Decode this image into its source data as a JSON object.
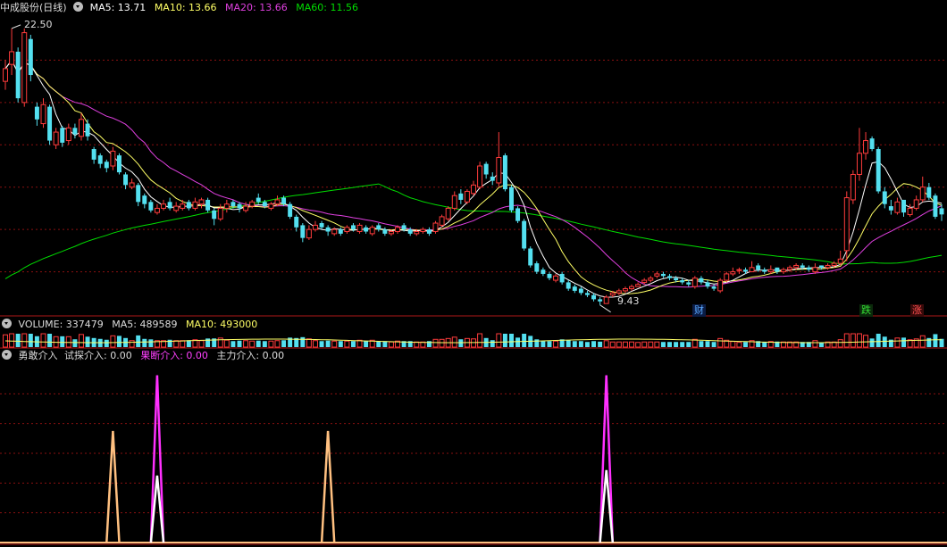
{
  "colors": {
    "bg": "#000000",
    "grid": "#8a1010",
    "up": "#ff3c3c",
    "down": "#54e0f0",
    "ma5": "#ffffff",
    "ma10": "#ffff66",
    "ma20": "#e040e0",
    "ma60": "#00dd00",
    "ind_orange": "#ffc080",
    "ind_magenta": "#ff30ff",
    "ind_white": "#ffffff",
    "label": "#dddddd"
  },
  "price_panel": {
    "title": "中成股份(日线)",
    "ma": [
      {
        "label": "MA5: 13.71",
        "color": "#ffffff"
      },
      {
        "label": "MA10: 13.66",
        "color": "#ffff66"
      },
      {
        "label": "MA20: 13.66",
        "color": "#e040e0"
      },
      {
        "label": "MA60: 11.56",
        "color": "#00dd00"
      }
    ],
    "high_label": "22.50",
    "low_label": "9.43",
    "tags": [
      {
        "text": "财",
        "color": "#5aa8ff",
        "bg": "#0b1c44"
      },
      {
        "text": "跌",
        "color": "#33dd33",
        "bg": "#0b2a0b"
      },
      {
        "text": "涨",
        "color": "#ff5050",
        "bg": "#3a0a0a"
      }
    ]
  },
  "volume_panel": {
    "items": [
      {
        "label": "VOLUME: 337479",
        "color": "#dddddd"
      },
      {
        "label": "MA5: 489589",
        "color": "#dddddd"
      },
      {
        "label": "MA10: 493000",
        "color": "#ffff66"
      }
    ]
  },
  "indicator_panel": {
    "items": [
      {
        "label": "勇敢介入",
        "color": "#dddddd"
      },
      {
        "label": "试探介入: 0.00",
        "color": "#dddddd"
      },
      {
        "label": "果断介入: 0.00",
        "color": "#ff40ff"
      },
      {
        "label": "主力介入: 0.00",
        "color": "#dddddd"
      }
    ]
  },
  "chart_data": [
    {
      "type": "candlestick",
      "title": "中成股份(日线)",
      "y_range": [
        9.0,
        23.0
      ],
      "high": 22.5,
      "low": 9.43,
      "closes": [
        20.6,
        21.4,
        19.2,
        22.3,
        20.3,
        18.2,
        18.9,
        17.2,
        17.6,
        17.1,
        17.8,
        17.5,
        18.2,
        17.4,
        16.3,
        16.1,
        15.9,
        16.7,
        15.7,
        15.1,
        15.2,
        14.3,
        14.2,
        13.9,
        14.0,
        14.2,
        14.0,
        14.1,
        14.2,
        14.0,
        14.3,
        14.4,
        13.9,
        13.5,
        14.0,
        14.2,
        14.1,
        14.0,
        14.1,
        14.3,
        14.3,
        14.1,
        14.2,
        14.4,
        14.2,
        13.6,
        13.1,
        12.6,
        13.0,
        13.2,
        13.1,
        12.9,
        13.0,
        12.8,
        13.1,
        13.0,
        13.2,
        12.9,
        13.1,
        13.0,
        12.8,
        12.9,
        13.1,
        13.0,
        12.8,
        12.9,
        13.0,
        12.8,
        13.3,
        13.6,
        14.0,
        14.6,
        14.4,
        14.8,
        15.1,
        16.0,
        15.6,
        15.3,
        16.4,
        14.9,
        13.9,
        13.4,
        12.1,
        11.3,
        11.0,
        10.9,
        10.7,
        10.8,
        10.5,
        10.2,
        10.1,
        10.0,
        9.9,
        9.7,
        9.6,
        9.8,
        10.0,
        10.1,
        10.2,
        10.3,
        10.4,
        10.6,
        10.7,
        10.9,
        10.8,
        10.7,
        10.6,
        10.5,
        10.4,
        10.7,
        10.5,
        10.3,
        10.2,
        10.6,
        10.9,
        11.0,
        11.1,
        11.0,
        11.2,
        11.1,
        11.0,
        11.1,
        11.0,
        11.1,
        11.2,
        11.3,
        11.2,
        11.1,
        11.2,
        11.2,
        11.3,
        11.4,
        11.6,
        14.5,
        15.6,
        16.6,
        17.2,
        16.8,
        14.8,
        14.2,
        13.9,
        14.3,
        13.8,
        14.0,
        14.4,
        15.0,
        14.5,
        13.6,
        13.71
      ],
      "opens": [
        20.0,
        20.8,
        21.4,
        19.0,
        22.0,
        18.8,
        18.0,
        18.8,
        17.0,
        17.8,
        17.2,
        17.8,
        17.4,
        18.0,
        16.8,
        16.5,
        16.2,
        16.0,
        16.5,
        15.6,
        15.0,
        15.1,
        14.6,
        14.3,
        13.8,
        14.0,
        14.3,
        13.9,
        14.0,
        14.3,
        14.0,
        14.2,
        14.4,
        13.9,
        13.5,
        14.0,
        14.3,
        14.2,
        13.9,
        14.1,
        14.5,
        14.3,
        14.0,
        14.2,
        14.5,
        14.2,
        13.6,
        13.2,
        12.6,
        13.0,
        13.3,
        13.1,
        12.8,
        13.0,
        12.9,
        13.2,
        12.9,
        13.1,
        12.8,
        13.2,
        13.0,
        12.8,
        12.9,
        13.2,
        13.0,
        12.8,
        12.9,
        13.0,
        12.9,
        13.2,
        13.5,
        14.0,
        14.7,
        14.3,
        14.7,
        15.0,
        16.1,
        15.5,
        15.2,
        16.5,
        15.0,
        14.0,
        13.4,
        12.1,
        11.4,
        11.1,
        10.9,
        10.6,
        10.9,
        10.5,
        10.3,
        10.2,
        10.0,
        9.9,
        9.7,
        9.5,
        9.9,
        10.0,
        10.1,
        10.2,
        10.3,
        10.5,
        10.6,
        10.8,
        10.9,
        10.8,
        10.7,
        10.6,
        10.5,
        10.3,
        10.7,
        10.5,
        10.3,
        10.1,
        10.6,
        10.9,
        11.1,
        11.1,
        11.0,
        11.3,
        11.1,
        11.0,
        11.2,
        11.0,
        11.1,
        11.2,
        11.3,
        11.2,
        11.0,
        11.3,
        11.2,
        11.3,
        11.4,
        12.0,
        14.4,
        15.6,
        16.6,
        17.3,
        16.8,
        14.8,
        14.1,
        13.8,
        14.4,
        13.7,
        14.0,
        14.4,
        15.0,
        14.6,
        14.0
      ],
      "highs": [
        21.0,
        22.5,
        21.6,
        22.5,
        22.2,
        19.0,
        19.2,
        18.9,
        17.8,
        17.9,
        18.0,
        18.0,
        18.5,
        18.2,
        16.9,
        16.6,
        16.3,
        16.9,
        16.6,
        15.7,
        15.4,
        15.2,
        14.7,
        14.4,
        14.2,
        14.4,
        14.5,
        14.3,
        14.4,
        14.4,
        14.5,
        14.5,
        14.5,
        14.0,
        14.2,
        14.4,
        14.4,
        14.3,
        14.3,
        14.4,
        14.7,
        14.4,
        14.3,
        14.6,
        14.6,
        14.3,
        13.7,
        13.3,
        13.2,
        13.4,
        13.4,
        13.2,
        13.1,
        13.1,
        13.2,
        13.3,
        13.3,
        13.2,
        13.2,
        13.3,
        13.1,
        13.0,
        13.2,
        13.3,
        13.1,
        13.0,
        13.1,
        13.1,
        13.4,
        13.7,
        14.1,
        14.8,
        14.9,
        14.9,
        15.3,
        16.2,
        16.2,
        15.7,
        17.6,
        16.6,
        15.1,
        14.1,
        13.5,
        12.2,
        11.5,
        11.2,
        11.0,
        10.9,
        11.0,
        10.6,
        10.4,
        10.3,
        10.1,
        10.0,
        9.8,
        9.9,
        10.1,
        10.2,
        10.3,
        10.4,
        10.5,
        10.7,
        10.8,
        11.0,
        11.0,
        10.9,
        10.8,
        10.7,
        10.6,
        10.8,
        10.8,
        10.6,
        10.4,
        10.7,
        11.0,
        11.2,
        11.2,
        11.2,
        11.5,
        11.4,
        11.2,
        11.3,
        11.2,
        11.2,
        11.3,
        11.4,
        11.4,
        11.3,
        11.4,
        11.3,
        11.4,
        11.5,
        12.0,
        14.8,
        15.8,
        17.8,
        17.6,
        17.4,
        16.9,
        15.0,
        14.4,
        14.5,
        14.4,
        14.2,
        14.6,
        15.5,
        15.2,
        14.7,
        14.2
      ],
      "lows": [
        19.6,
        20.3,
        19.0,
        18.8,
        20.0,
        17.9,
        17.8,
        17.0,
        16.8,
        16.9,
        17.0,
        17.3,
        17.2,
        17.2,
        16.1,
        15.9,
        15.7,
        15.8,
        15.6,
        14.9,
        14.9,
        14.1,
        14.0,
        13.8,
        13.7,
        13.9,
        13.9,
        13.8,
        13.9,
        13.9,
        13.9,
        14.0,
        13.8,
        13.2,
        13.4,
        13.8,
        14.0,
        13.8,
        13.8,
        14.0,
        14.2,
        14.0,
        13.9,
        14.1,
        14.1,
        13.5,
        12.9,
        12.4,
        12.5,
        12.9,
        13.0,
        12.7,
        12.7,
        12.7,
        12.8,
        12.9,
        12.8,
        12.8,
        12.7,
        12.9,
        12.7,
        12.7,
        12.8,
        12.9,
        12.7,
        12.7,
        12.8,
        12.7,
        12.8,
        13.1,
        13.4,
        13.9,
        14.2,
        14.2,
        14.6,
        14.9,
        15.4,
        15.1,
        15.0,
        14.8,
        13.8,
        13.3,
        12.0,
        11.2,
        10.9,
        10.8,
        10.6,
        10.5,
        10.4,
        10.1,
        10.0,
        9.9,
        9.8,
        9.6,
        9.43,
        9.5,
        9.8,
        9.9,
        10.0,
        10.1,
        10.3,
        10.4,
        10.5,
        10.7,
        10.7,
        10.6,
        10.5,
        10.4,
        10.3,
        10.2,
        10.4,
        10.2,
        10.1,
        10.0,
        10.5,
        10.8,
        10.9,
        10.9,
        11.0,
        11.0,
        10.9,
        10.9,
        10.9,
        10.9,
        11.0,
        11.1,
        11.1,
        11.0,
        10.9,
        11.1,
        11.1,
        11.2,
        11.3,
        11.5,
        14.2,
        15.3,
        16.3,
        16.7,
        14.7,
        14.0,
        13.7,
        13.7,
        13.6,
        13.6,
        13.9,
        14.3,
        14.4,
        13.5,
        13.4
      ],
      "ma5_last": 13.71,
      "ma10_last": 13.66,
      "ma20_last": 13.66,
      "ma60_last": 11.56
    },
    {
      "type": "bar",
      "title": "VOLUME",
      "volume_last": 337479,
      "ma5_last": 489589,
      "ma10_last": 493000
    },
    {
      "type": "line",
      "title": "勇敢介入",
      "series": [
        {
          "name": "试探介入",
          "color": "#ffc080",
          "spikes": [
            {
              "index": 17,
              "value": 1.0
            },
            {
              "index": 51,
              "value": 1.0
            }
          ]
        },
        {
          "name": "果断介入",
          "color": "#ff30ff",
          "spikes": [
            {
              "index": 24,
              "value": 1.5
            },
            {
              "index": 95,
              "value": 1.5
            }
          ]
        },
        {
          "name": "主力介入",
          "color": "#ffffff",
          "spikes": [
            {
              "index": 24,
              "value": 0.6
            },
            {
              "index": 95,
              "value": 0.65
            }
          ]
        }
      ],
      "y_range": [
        0,
        1.6
      ]
    }
  ]
}
